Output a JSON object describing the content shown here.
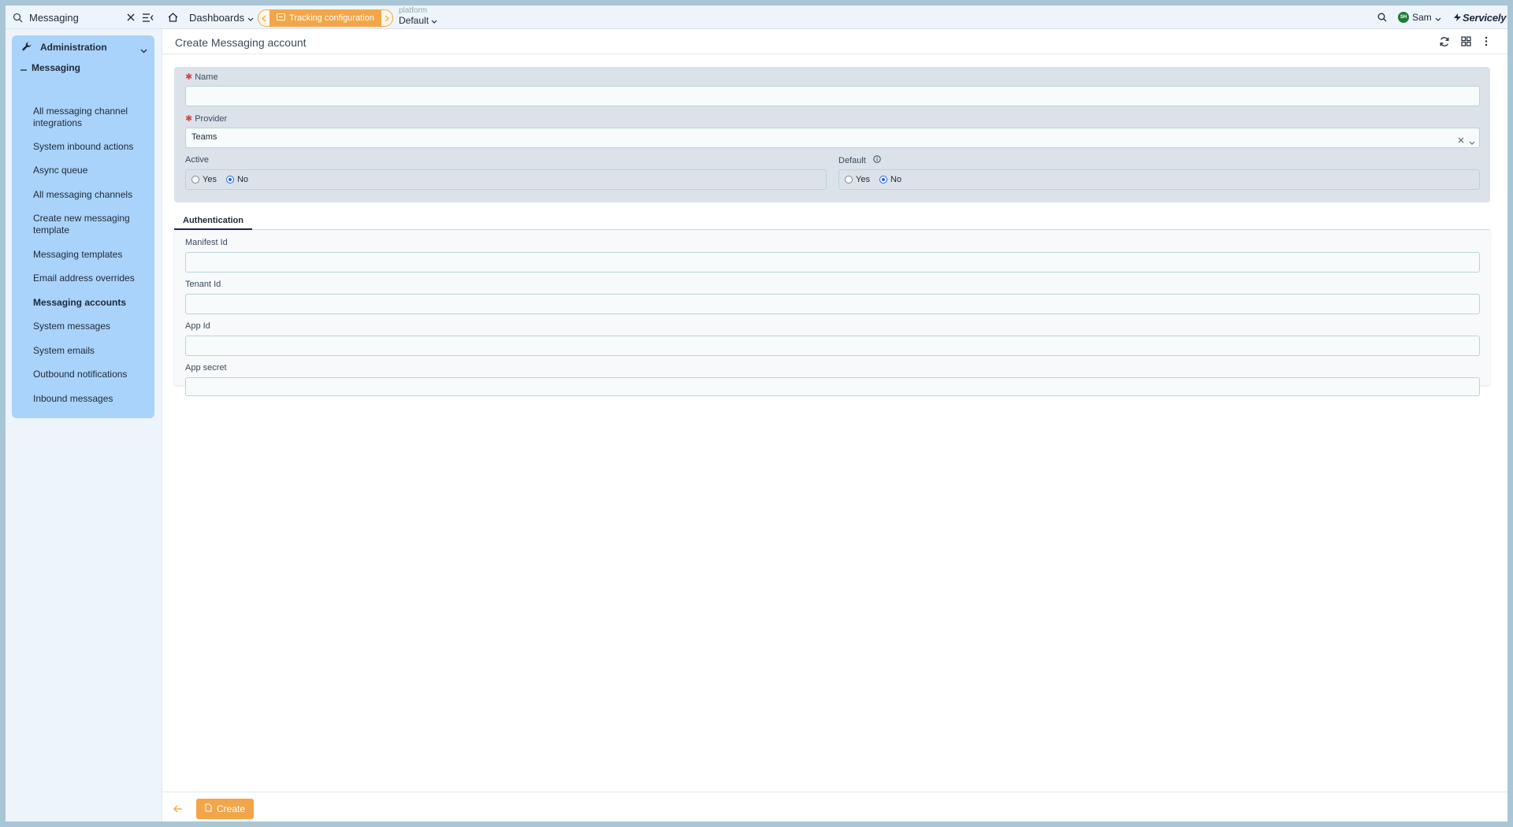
{
  "topbar": {
    "search_value": "Messaging",
    "dashboards_label": "Dashboards",
    "breadcrumb_label": "Tracking configuration",
    "platform_label": "platform",
    "platform_value": "Default",
    "user_initials": "SH",
    "user_name": "Sam",
    "brand": "Servicely"
  },
  "sidebar": {
    "section_title": "Administration",
    "group_title": "Messaging",
    "items": [
      {
        "label": "All messaging channel integrations"
      },
      {
        "label": "System inbound actions"
      },
      {
        "label": "Async queue"
      },
      {
        "label": "All messaging channels"
      },
      {
        "label": "Create new messaging template"
      },
      {
        "label": "Messaging templates"
      },
      {
        "label": "Email address overrides"
      },
      {
        "label": "Messaging accounts"
      },
      {
        "label": "System messages"
      },
      {
        "label": "System emails"
      },
      {
        "label": "Outbound notifications"
      },
      {
        "label": "Inbound messages"
      }
    ]
  },
  "page": {
    "title": "Create Messaging account"
  },
  "form": {
    "name_label": "Name",
    "name_value": "",
    "provider_label": "Provider",
    "provider_value": "Teams",
    "active_label": "Active",
    "active_yes": "Yes",
    "active_no": "No",
    "active_selected": "No",
    "default_label": "Default",
    "default_yes": "Yes",
    "default_no": "No",
    "default_selected": "No"
  },
  "tabs": {
    "authentication": "Authentication"
  },
  "auth": {
    "manifest_label": "Manifest Id",
    "tenant_label": "Tenant Id",
    "app_id_label": "App Id",
    "app_secret_label": "App secret"
  },
  "footer": {
    "create_label": "Create"
  },
  "colors": {
    "accent": "#f3a649",
    "sidebar": "#a9d3fb",
    "card": "#dce2ea"
  }
}
